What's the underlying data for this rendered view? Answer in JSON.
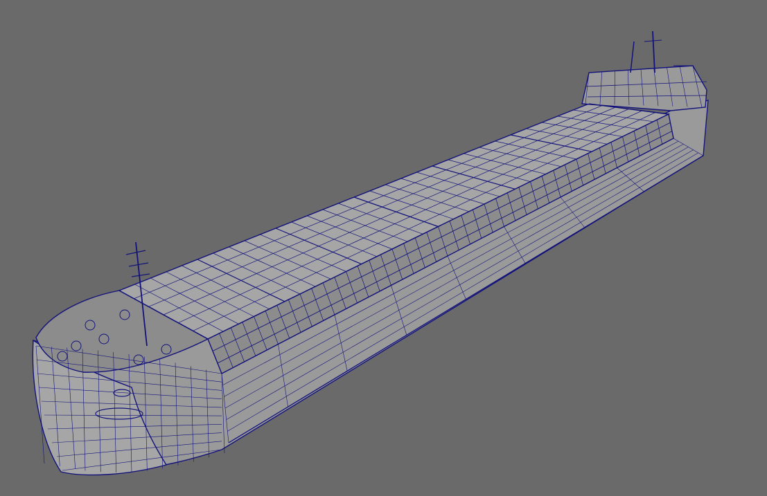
{
  "viewport": {
    "background": "#6a6a6a",
    "view_mode": "wireframe-on-shaded"
  },
  "model": {
    "subject": "cargo-ship",
    "wire_color": "#12127a",
    "shade_color": "#9a9a9a",
    "shade_dark": "#8c8c8c",
    "shade_light": "#a6a6a6"
  }
}
